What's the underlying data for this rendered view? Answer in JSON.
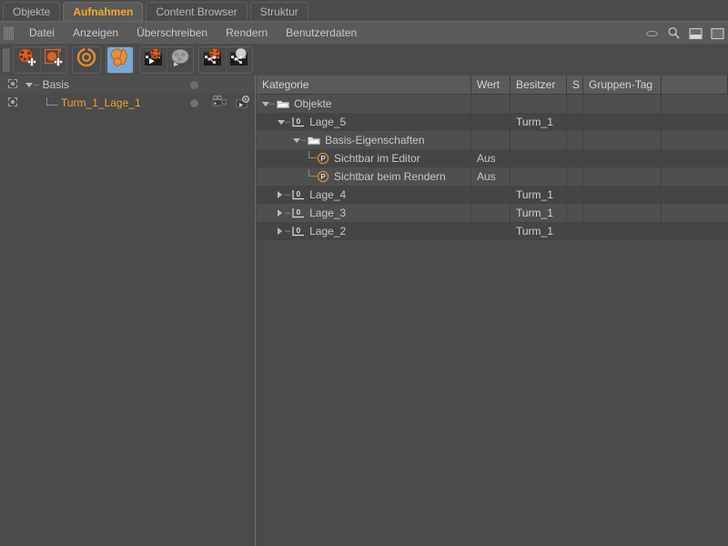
{
  "window": {
    "title": "Aufnahmen",
    "accent_color": "#f0a030",
    "background": "#4b4b4b"
  },
  "tabs": [
    {
      "label": "Objekte",
      "active": false
    },
    {
      "label": "Aufnahmen",
      "active": true
    },
    {
      "label": "Content Browser",
      "active": false
    },
    {
      "label": "Struktur",
      "active": false
    }
  ],
  "menubar": {
    "grip_icon": "drag-grip-icon",
    "items": [
      {
        "label": "Datei"
      },
      {
        "label": "Anzeigen"
      },
      {
        "label": "Überschreiben"
      },
      {
        "label": "Rendern"
      },
      {
        "label": "Benutzerdaten"
      }
    ],
    "right_icons": [
      {
        "name": "eye-icon"
      },
      {
        "name": "search-icon"
      },
      {
        "name": "split-view-icon"
      },
      {
        "name": "maximize-icon"
      }
    ]
  },
  "toolbar": {
    "grip_icon": "drag-grip-icon",
    "groups": [
      {
        "buttons": [
          {
            "name": "add-take-button",
            "icon": "take-add-icon",
            "selected": false
          },
          {
            "name": "add-child-take-button",
            "icon": "take-child-add-icon",
            "selected": false
          }
        ]
      },
      {
        "buttons": [
          {
            "name": "auto-take-mode-button",
            "icon": "auto-take-icon",
            "selected": false
          }
        ]
      },
      {
        "buttons": [
          {
            "name": "override-group-button",
            "icon": "override-group-icon",
            "selected": true
          }
        ]
      },
      {
        "buttons": [
          {
            "name": "render-take-button",
            "icon": "render-take-icon",
            "selected": false
          },
          {
            "name": "render-all-takes-button",
            "icon": "render-all-takes-icon",
            "selected": false
          }
        ]
      },
      {
        "buttons": [
          {
            "name": "take-to-render-queue-button",
            "icon": "take-queue-icon",
            "selected": false
          },
          {
            "name": "all-takes-to-render-queue-button",
            "icon": "all-takes-queue-icon",
            "selected": false
          }
        ]
      }
    ]
  },
  "take_tree": {
    "rows": [
      {
        "name": "Basis",
        "depth": 0,
        "expanded": true,
        "selected": false,
        "has_bullet": true,
        "extra_tags": [],
        "crosshair_icon": "take-marker-icon"
      },
      {
        "name": "Turm_1_Lage_1",
        "depth": 1,
        "expanded": null,
        "selected": true,
        "has_bullet": true,
        "extra_tags": [
          "camera-tag-icon",
          "render-settings-tag-icon"
        ],
        "crosshair_icon": "take-marker-icon"
      }
    ]
  },
  "attribute_table": {
    "columns": [
      {
        "key": "kategorie",
        "label": "Kategorie"
      },
      {
        "key": "wert",
        "label": "Wert"
      },
      {
        "key": "besitzer",
        "label": "Besitzer"
      },
      {
        "key": "s",
        "label": "S"
      },
      {
        "key": "gruppen_tag",
        "label": "Gruppen-Tag"
      },
      {
        "key": "spacer",
        "label": ""
      }
    ],
    "rows": [
      {
        "kategorie": "Objekte",
        "depth": 0,
        "expander": "down",
        "icon": "folder-icon",
        "wert": "",
        "besitzer": "",
        "s": "",
        "gruppen_tag": ""
      },
      {
        "kategorie": "Lage_5",
        "depth": 1,
        "expander": "down",
        "icon": "object-layer-icon",
        "wert": "",
        "besitzer": "Turm_1",
        "s": "",
        "gruppen_tag": ""
      },
      {
        "kategorie": "Basis-Eigenschaften",
        "depth": 2,
        "expander": "down",
        "icon": "folder-icon",
        "wert": "",
        "besitzer": "",
        "s": "",
        "gruppen_tag": ""
      },
      {
        "kategorie": "Sichtbar im Editor",
        "depth": 3,
        "expander": "none",
        "icon": "parameter-icon",
        "wert": "Aus",
        "besitzer": "",
        "s": "",
        "gruppen_tag": ""
      },
      {
        "kategorie": "Sichtbar beim Rendern",
        "depth": 3,
        "expander": "none",
        "icon": "parameter-icon",
        "wert": "Aus",
        "besitzer": "",
        "s": "",
        "gruppen_tag": ""
      },
      {
        "kategorie": "Lage_4",
        "depth": 1,
        "expander": "right",
        "icon": "object-layer-icon",
        "wert": "",
        "besitzer": "Turm_1",
        "s": "",
        "gruppen_tag": ""
      },
      {
        "kategorie": "Lage_3",
        "depth": 1,
        "expander": "right",
        "icon": "object-layer-icon",
        "wert": "",
        "besitzer": "Turm_1",
        "s": "",
        "gruppen_tag": ""
      },
      {
        "kategorie": "Lage_2",
        "depth": 1,
        "expander": "right",
        "icon": "object-layer-icon",
        "wert": "",
        "besitzer": "Turm_1",
        "s": "",
        "gruppen_tag": ""
      }
    ]
  }
}
